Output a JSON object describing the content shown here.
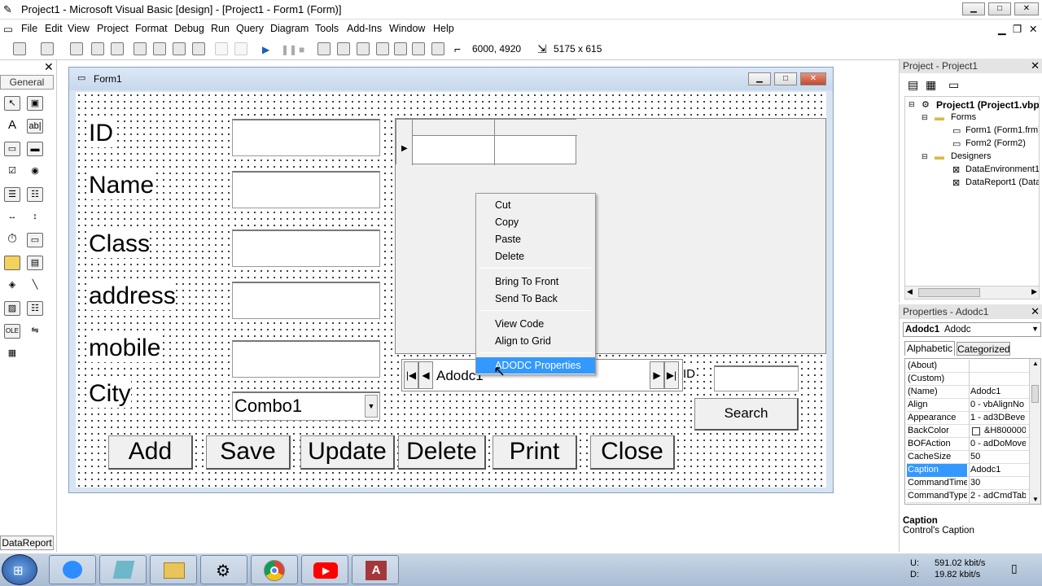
{
  "window": {
    "title": "Project1 - Microsoft Visual Basic [design] - [Project1 - Form1 (Form)]"
  },
  "menu": [
    "File",
    "Edit",
    "View",
    "Project",
    "Format",
    "Debug",
    "Run",
    "Query",
    "Diagram",
    "Tools",
    "Add-Ins",
    "Window",
    "Help"
  ],
  "toolbar": {
    "position": "6000, 4920",
    "size": "5175 x 615"
  },
  "toolbox": {
    "title": "General",
    "footer": "DataReport"
  },
  "form": {
    "title": "Form1",
    "labels": [
      "ID",
      "Name",
      "Class",
      "address",
      "mobile",
      "City"
    ],
    "combo": "Combo1",
    "adodc_caption": "Adodc1",
    "search_label": "Search",
    "hidden_id": "ID",
    "buttons": [
      "Add",
      "Save",
      "Update",
      "Delete",
      "Print",
      "Close"
    ]
  },
  "context_menu": {
    "items": [
      "Cut",
      "Copy",
      "Paste",
      "Delete",
      "Bring To Front",
      "Send To Back",
      "View Code",
      "Align to Grid",
      "ADODC Properties"
    ],
    "selected": "ADODC Properties"
  },
  "project": {
    "title": "Project - Project1",
    "tree": [
      "Project1 (Project1.vbp)",
      "Forms",
      "Form1 (Form1.frm)",
      "Form2 (Form2)",
      "Designers",
      "DataEnvironment1",
      "DataReport1 (Data"
    ]
  },
  "properties": {
    "title": "Properties - Adodc1",
    "object": "Adodc1",
    "object_type": "Adodc",
    "tabs": [
      "Alphabetic",
      "Categorized"
    ],
    "rows": [
      [
        "(About)",
        ""
      ],
      [
        "(Custom)",
        ""
      ],
      [
        "(Name)",
        "Adodc1"
      ],
      [
        "Align",
        "0 - vbAlignNo"
      ],
      [
        "Appearance",
        "1 - ad3DBeve"
      ],
      [
        "BackColor",
        "&H800000"
      ],
      [
        "BOFAction",
        "0 - adDoMove"
      ],
      [
        "CacheSize",
        "50"
      ],
      [
        "Caption",
        "Adodc1"
      ],
      [
        "CommandTimeo",
        "30"
      ],
      [
        "CommandType",
        "2 - adCmdTab"
      ]
    ],
    "selected_row": "Caption",
    "desc_title": "Caption",
    "desc_text": "Control's Caption"
  },
  "taskbar": {
    "net_up": "591.02 kbit/s",
    "net_down": "19.82 kbit/s",
    "u": "U:",
    "d": "D:"
  },
  "colors": {
    "select": "#3399ff",
    "form_title": "#c7d8ec",
    "taskbar": "#b8c9dd"
  }
}
